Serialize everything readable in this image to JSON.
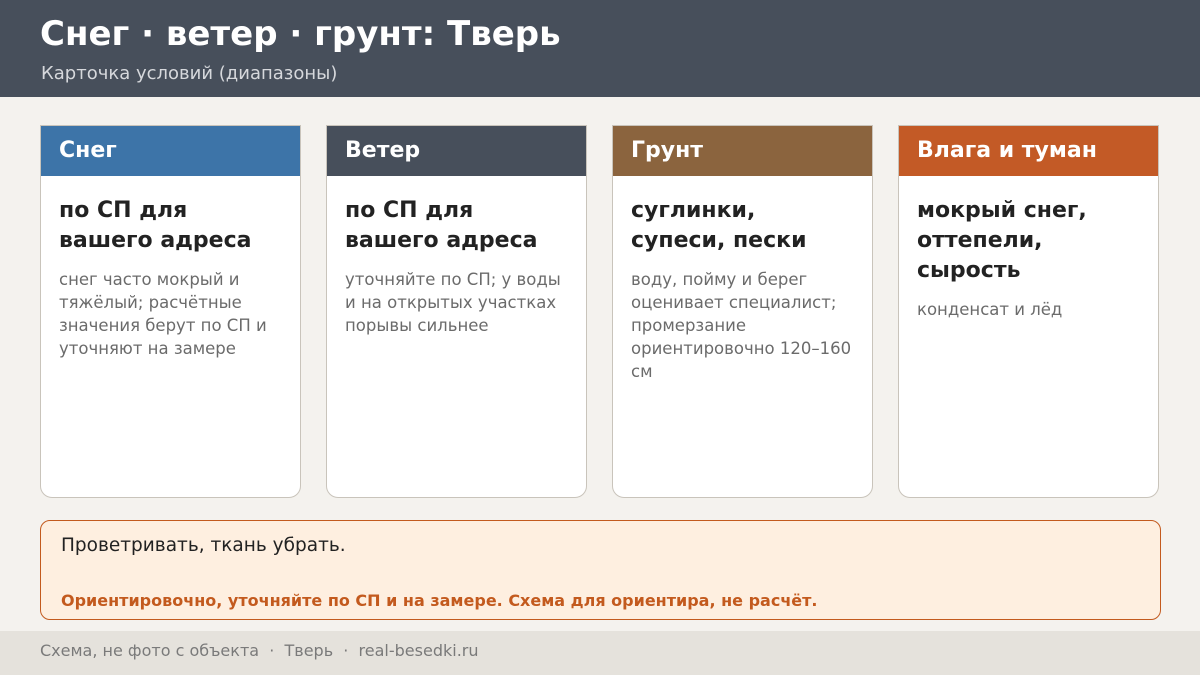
{
  "header": {
    "title": "Снег · ветер · грунт: Тверь",
    "subtitle": "Карточка условий (диапазоны)",
    "background": "#474f5b"
  },
  "cards": [
    {
      "title": "Снег",
      "color": "#3d74a8",
      "main": "по СП для вашего адреса",
      "note": "снег часто мокрый и тяжёлый; расчётные значения берут по СП и уточняют на замере"
    },
    {
      "title": "Ветер",
      "color": "#474f5b",
      "main": "по СП для вашего адреса",
      "note": "уточняйте по СП; у воды и на открытых участках порывы сильнее"
    },
    {
      "title": "Грунт",
      "color": "#8b643e",
      "main": "суглинки, супеси, пески",
      "note": "воду, пойму и берег оценивает специалист; промерзание ориентировочно 120–160 см"
    },
    {
      "title": "Влага и туман",
      "color": "#c35a26",
      "main": "мокрый снег, оттепели, сырость",
      "note": "конденсат и лёд"
    }
  ],
  "callout": {
    "text": "Проветривать, ткань убрать.",
    "warning": "Ориентировочно, уточняйте по СП и на замере. Схема для ориентира, не расчёт.",
    "accent": "#c35a1e"
  },
  "footer": {
    "text": "Схема, не фото с объекта  ·  Тверь  ·  real-besedki.ru"
  }
}
